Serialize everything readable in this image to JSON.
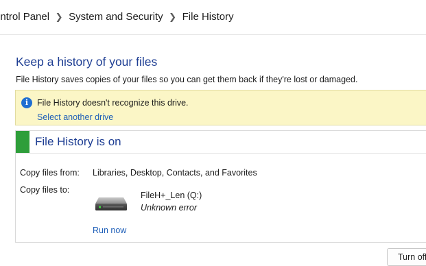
{
  "breadcrumb": {
    "items": [
      "ontrol Panel",
      "System and Security",
      "File History"
    ],
    "separator_icon": "chevron-right-icon"
  },
  "page": {
    "title": "Keep a history of your files",
    "description": "File History saves copies of your files so you can get them back if they're lost or damaged."
  },
  "warning": {
    "icon": "info-icon",
    "message": "File History doesn't recognize this drive.",
    "link": "Select another drive",
    "background": "#fbf6c6"
  },
  "status": {
    "title": "File History is on",
    "indicator_color": "#2e9e3a",
    "copy_from_label": "Copy files from:",
    "copy_from_value": "Libraries, Desktop, Contacts, and Favorites",
    "copy_to_label": "Copy files to:",
    "drive": {
      "icon": "hard-drive-icon",
      "name": "FileH+_Len (Q:)",
      "error": "Unknown error"
    },
    "run_now": "Run now"
  },
  "actions": {
    "turn_off": "Turn off"
  },
  "colors": {
    "title_blue": "#1e3e93",
    "link_blue": "#1f5fb8",
    "info_blue": "#1f6fd1"
  }
}
